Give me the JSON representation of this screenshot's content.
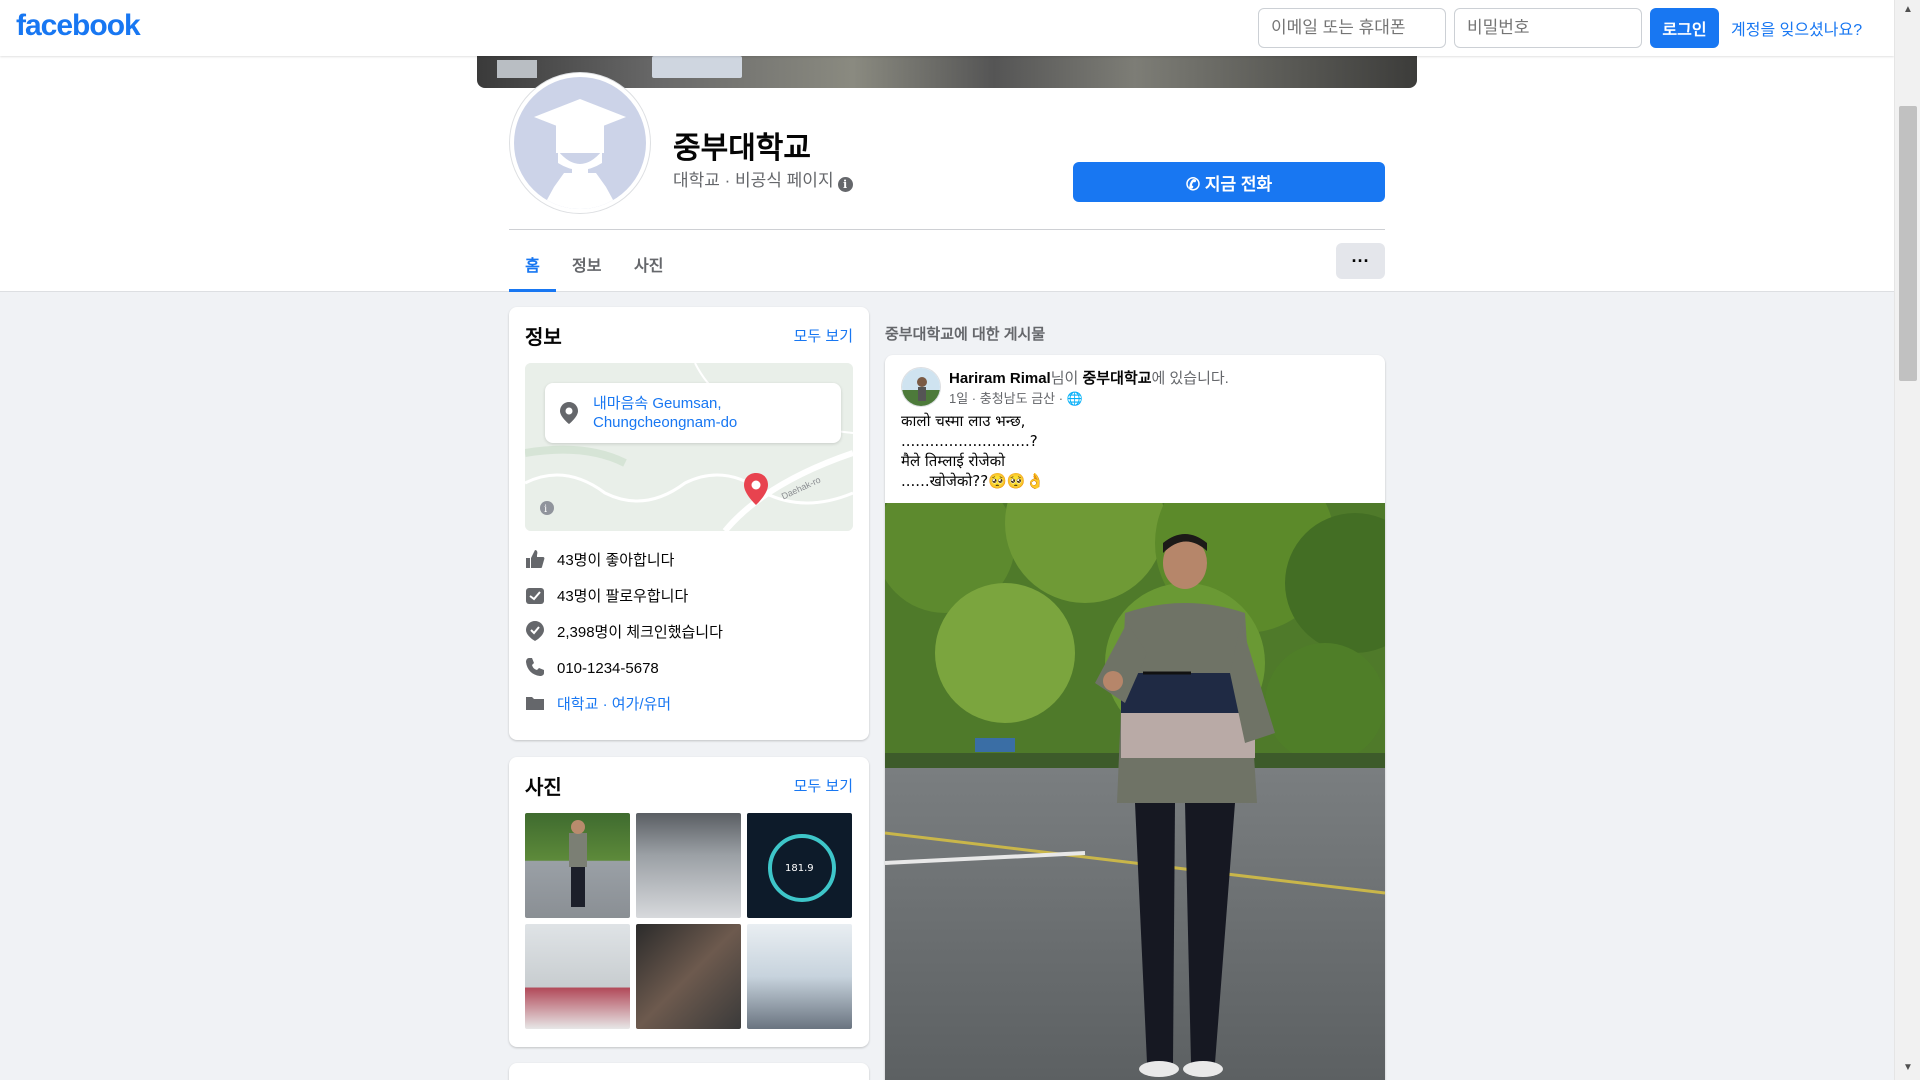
{
  "nav": {
    "logo": "facebook",
    "email_placeholder": "이메일 또는 휴대폰",
    "password_placeholder": "비밀번호",
    "login_label": "로그인",
    "forgot_label": "계정을 잊으셨나요?"
  },
  "page": {
    "title": "중부대학교",
    "subtitle": "대학교 · 비공식 페이지",
    "call_label": "지금 전화"
  },
  "tabs": [
    {
      "label": "홈"
    },
    {
      "label": "정보"
    },
    {
      "label": "사진"
    }
  ],
  "more_label": "···",
  "info_card": {
    "title": "정보",
    "see_all": "모두 보기",
    "map_label": "내마음속 Geumsan, Chungcheongnam-do",
    "map_road": "Daehak-ro",
    "likes": "43명이 좋아합니다",
    "follows": "43명이 팔로우합니다",
    "checkins": "2,398명이 체크인했습니다",
    "phone": "010-1234-5678",
    "category": "대학교 · 여가/유머"
  },
  "photos_card": {
    "title": "사진",
    "see_all": "모두 보기"
  },
  "posts": {
    "heading": "중부대학교에 대한 게시물",
    "author": "Hariram Rimal",
    "connector": "님이 ",
    "place": "중부대학교",
    "suffix": "에 있습니다.",
    "meta": "1일 · 충청남도 금산 ·",
    "text": "कालो चस्मा लाउ भन्छ,\n...........................?\nमैले तिम्लाई रोजेको\n......खोजेको??🥺🥺👌"
  },
  "colors": {
    "brand": "#1877f2",
    "background": "#f0f2f5",
    "secondary_text": "#65676b"
  }
}
